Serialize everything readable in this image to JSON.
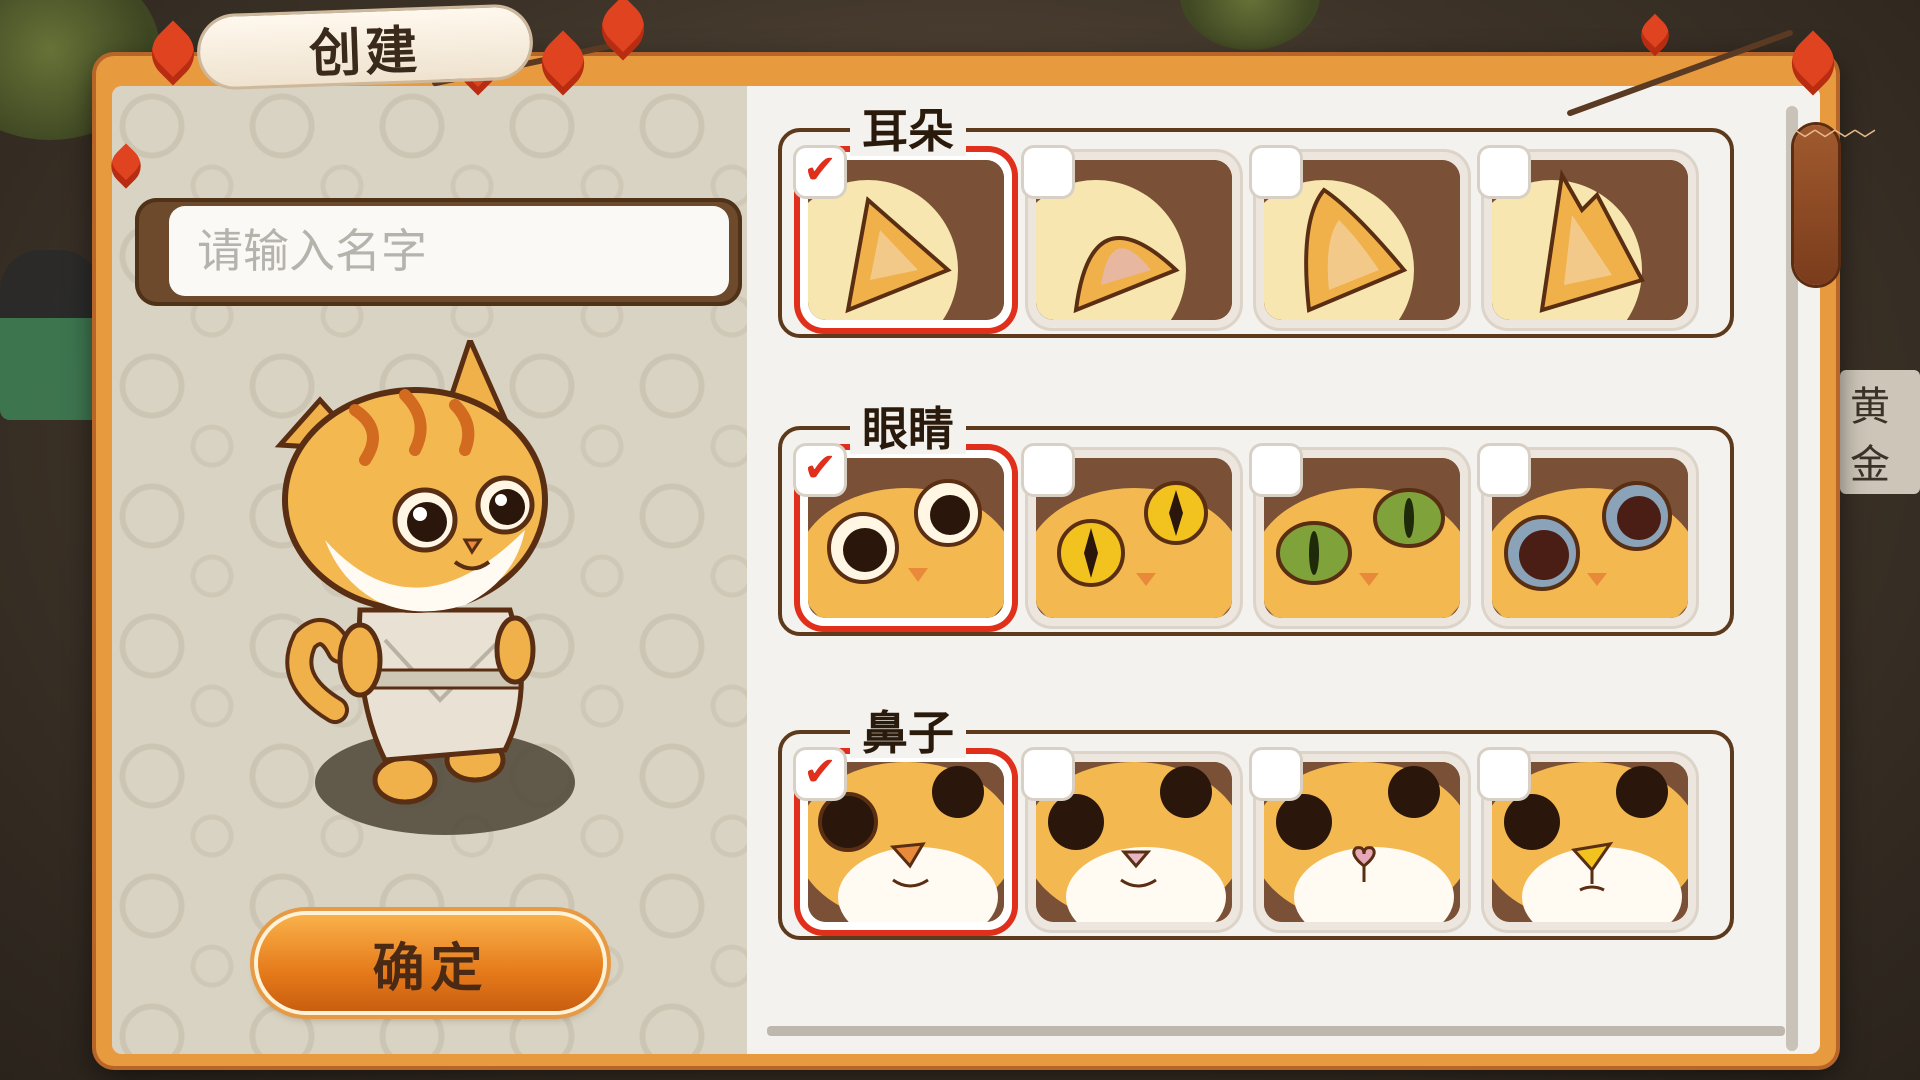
{
  "window": {
    "title": "创建",
    "background_sign_text": "黄金",
    "accent_color": "#e57a1a",
    "selection_color": "#e0301c",
    "frame_color": "#e89a3f"
  },
  "name_input": {
    "placeholder": "请输入名字",
    "value": ""
  },
  "confirm_button": {
    "label": "确定"
  },
  "sections": [
    {
      "title": "耳朵",
      "options": [
        {
          "id": "ear-1",
          "selected": true,
          "checkmark": "✔"
        },
        {
          "id": "ear-2",
          "selected": false,
          "checkmark": ""
        },
        {
          "id": "ear-3",
          "selected": false,
          "checkmark": ""
        },
        {
          "id": "ear-4",
          "selected": false,
          "checkmark": ""
        }
      ]
    },
    {
      "title": "眼睛",
      "options": [
        {
          "id": "eye-1",
          "selected": true,
          "checkmark": "✔"
        },
        {
          "id": "eye-2",
          "selected": false,
          "checkmark": ""
        },
        {
          "id": "eye-3",
          "selected": false,
          "checkmark": ""
        },
        {
          "id": "eye-4",
          "selected": false,
          "checkmark": ""
        }
      ]
    },
    {
      "title": "鼻子",
      "options": [
        {
          "id": "nose-1",
          "selected": true,
          "checkmark": "✔"
        },
        {
          "id": "nose-2",
          "selected": false,
          "checkmark": ""
        },
        {
          "id": "nose-3",
          "selected": false,
          "checkmark": ""
        },
        {
          "id": "nose-4",
          "selected": false,
          "checkmark": ""
        }
      ]
    }
  ],
  "scrollbar": {
    "handle_glyph": "﹀﹀﹀﹀"
  },
  "icons": {
    "checkmark": "check-icon",
    "scroll_handle": "scroll-handle-icon",
    "leaf": "maple-leaf-icon"
  }
}
